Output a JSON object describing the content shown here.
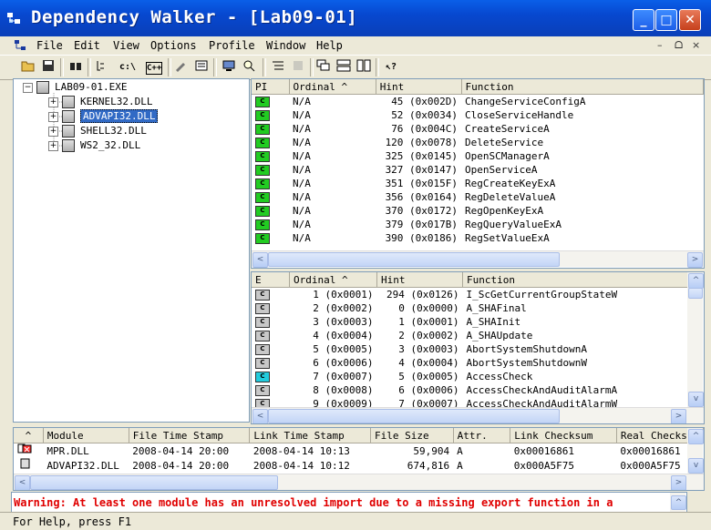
{
  "window": {
    "title": "Dependency Walker - [Lab09-01]",
    "minimize": "_",
    "maximize": "□",
    "close": "✕"
  },
  "menu": [
    "File",
    "Edit",
    "View",
    "Options",
    "Profile",
    "Window",
    "Help"
  ],
  "mdi_controls": [
    "–",
    "ᗝ",
    "×"
  ],
  "tree": {
    "root": "LAB09-01.EXE",
    "children": [
      "KERNEL32.DLL",
      "ADVAPI32.DLL",
      "SHELL32.DLL",
      "WS2_32.DLL"
    ],
    "selected": "ADVAPI32.DLL"
  },
  "imports": {
    "headers": [
      "PI",
      "Ordinal ^",
      "Hint",
      "Function"
    ],
    "rows": [
      {
        "ordinal": "N/A",
        "hint": "45  (0x002D)",
        "function": "ChangeServiceConfigA"
      },
      {
        "ordinal": "N/A",
        "hint": "52  (0x0034)",
        "function": "CloseServiceHandle"
      },
      {
        "ordinal": "N/A",
        "hint": "76  (0x004C)",
        "function": "CreateServiceA"
      },
      {
        "ordinal": "N/A",
        "hint": "120  (0x0078)",
        "function": "DeleteService"
      },
      {
        "ordinal": "N/A",
        "hint": "325  (0x0145)",
        "function": "OpenSCManagerA"
      },
      {
        "ordinal": "N/A",
        "hint": "327  (0x0147)",
        "function": "OpenServiceA"
      },
      {
        "ordinal": "N/A",
        "hint": "351  (0x015F)",
        "function": "RegCreateKeyExA"
      },
      {
        "ordinal": "N/A",
        "hint": "356  (0x0164)",
        "function": "RegDeleteValueA"
      },
      {
        "ordinal": "N/A",
        "hint": "370  (0x0172)",
        "function": "RegOpenKeyExA"
      },
      {
        "ordinal": "N/A",
        "hint": "379  (0x017B)",
        "function": "RegQueryValueExA"
      },
      {
        "ordinal": "N/A",
        "hint": "390  (0x0186)",
        "function": "RegSetValueExA"
      }
    ]
  },
  "exports": {
    "headers": [
      "E",
      "Ordinal ^",
      "Hint",
      "Function"
    ],
    "rows": [
      {
        "icon": "gray",
        "ordinal": "1  (0x0001)",
        "hint": "294  (0x0126)",
        "function": "I_ScGetCurrentGroupStateW"
      },
      {
        "icon": "gray",
        "ordinal": "2  (0x0002)",
        "hint": "0  (0x0000)",
        "function": "A_SHAFinal"
      },
      {
        "icon": "gray",
        "ordinal": "3  (0x0003)",
        "hint": "1  (0x0001)",
        "function": "A_SHAInit"
      },
      {
        "icon": "gray",
        "ordinal": "4  (0x0004)",
        "hint": "2  (0x0002)",
        "function": "A_SHAUpdate"
      },
      {
        "icon": "gray",
        "ordinal": "5  (0x0005)",
        "hint": "3  (0x0003)",
        "function": "AbortSystemShutdownA"
      },
      {
        "icon": "gray",
        "ordinal": "6  (0x0006)",
        "hint": "4  (0x0004)",
        "function": "AbortSystemShutdownW"
      },
      {
        "icon": "cyan",
        "ordinal": "7  (0x0007)",
        "hint": "5  (0x0005)",
        "function": "AccessCheck"
      },
      {
        "icon": "gray",
        "ordinal": "8  (0x0008)",
        "hint": "6  (0x0006)",
        "function": "AccessCheckAndAuditAlarmA"
      },
      {
        "icon": "gray",
        "ordinal": "9  (0x0009)",
        "hint": "7  (0x0007)",
        "function": "AccessCheckAndAuditAlarmW"
      }
    ]
  },
  "modules": {
    "headers": [
      "^",
      "Module",
      "File Time Stamp",
      "Link Time Stamp",
      "File Size",
      "Attr.",
      "Link Checksum",
      "Real Checksum"
    ],
    "rows": [
      {
        "module": "MPR.DLL",
        "file_ts": "2008-04-14 20:00",
        "link_ts": "2008-04-14 10:13",
        "size": "59,904",
        "attr": "A",
        "link_checksum": "0x00016861",
        "real_checksum": "0x00016861"
      },
      {
        "module": "ADVAPI32.DLL",
        "file_ts": "2008-04-14 20:00",
        "link_ts": "2008-04-14 10:12",
        "size": "674,816",
        "attr": "A",
        "link_checksum": "0x000A5F75",
        "real_checksum": "0x000A5F75"
      }
    ]
  },
  "log": {
    "message": "Warning: At least one module has an unresolved import due to a missing export function in a"
  },
  "status": {
    "text": "For Help, press F1"
  },
  "icons": {
    "import_badge": "C",
    "export_badge": "C"
  }
}
